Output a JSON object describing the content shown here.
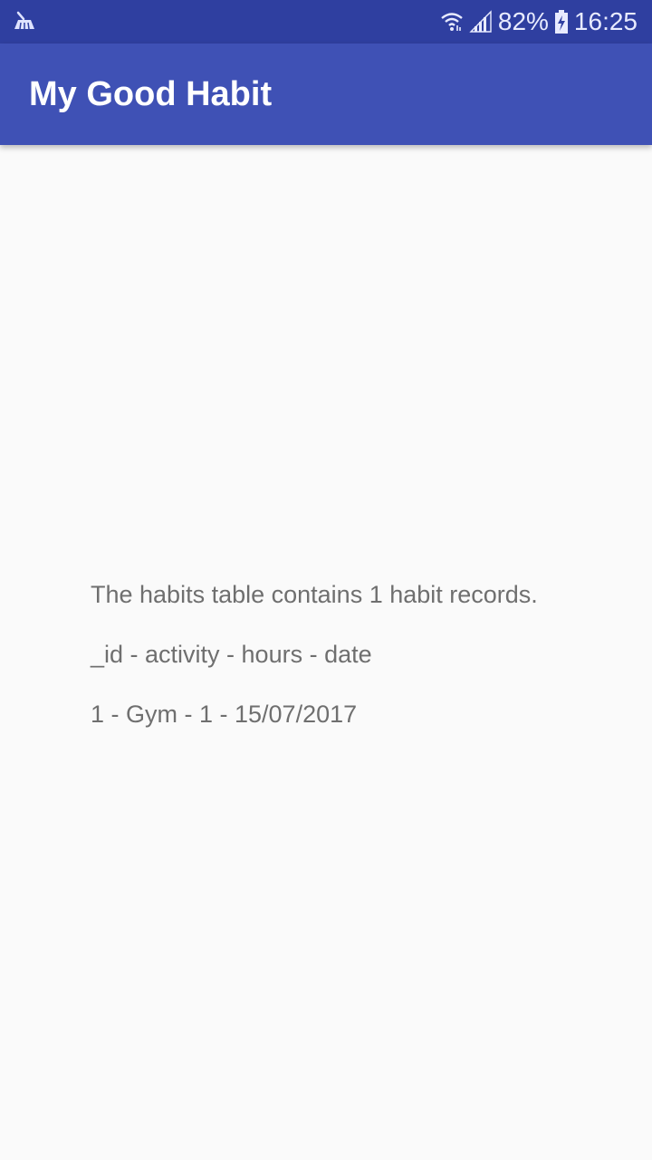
{
  "status_bar": {
    "left_icon": "cleaner-broom-icon",
    "wifi_icon": "wifi-icon",
    "signal_icon": "cell-signal-icon",
    "battery_percent": "82%",
    "battery_icon": "battery-charging-icon",
    "time": "16:25"
  },
  "app_bar": {
    "title": "My Good Habit",
    "color": "#3f51b5",
    "status_color": "#2f3fa0"
  },
  "content": {
    "summary": "The habits table contains 1 habit records.",
    "header": "_id - activity - hours - date",
    "rows": [
      "1 - Gym - 1 - 15/07/2017"
    ]
  }
}
